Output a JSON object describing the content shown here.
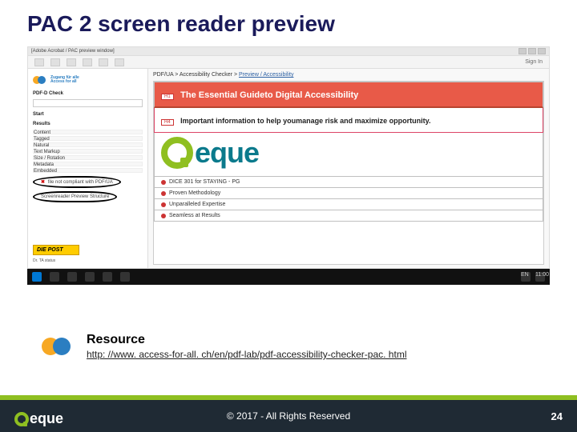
{
  "title": "PAC 2 screen reader preview",
  "window": {
    "title_hint": "[Adobe Acrobat / PAC preview window]"
  },
  "toolbar": {
    "signin": "Sign In"
  },
  "left_panel": {
    "org_line1": "Zugang für alle",
    "org_line2": "Access for all",
    "pdf_check": "PDF-D Check",
    "start": "Start",
    "results": "Results",
    "items": [
      "Content",
      "Tagged",
      "Natural",
      "Text Markup",
      "Size / Rotation",
      "Metadata",
      "Embedded"
    ],
    "circled_fail": "file not compliant with PDF/UA",
    "circled_row": "Screenreader Preview    Structure",
    "diepost": "DIE POST",
    "explain1": "Dr. TA",
    "explain2": "status"
  },
  "right_panel": {
    "header_prefix": "PDF/UA > Accessibility Checker > ",
    "header_link": "Preview / Accessibility",
    "bannerA_tag": "H1",
    "bannerA_text": "The Essential Guideto Digital Accessibility",
    "bannerB_tag": "H4",
    "bannerB_text": "Important information to help youmanage risk and maximize opportunity.",
    "brand": "eque",
    "rows": [
      "DICE 301 for STAYING - PG",
      "Proven Methodology",
      "Unparalleled Expertise",
      "Seamless at Results"
    ]
  },
  "taskbar": {
    "time": "11:00",
    "date": "",
    "tray": "EN"
  },
  "resource": {
    "heading": "Resource",
    "url": "http: //www. access-for-all. ch/en/pdf-lab/pdf-accessibility-checker-pac. html"
  },
  "footer": {
    "logo_text": "eque",
    "copyright": "© 2017 - All Rights Reserved",
    "page": "24"
  }
}
